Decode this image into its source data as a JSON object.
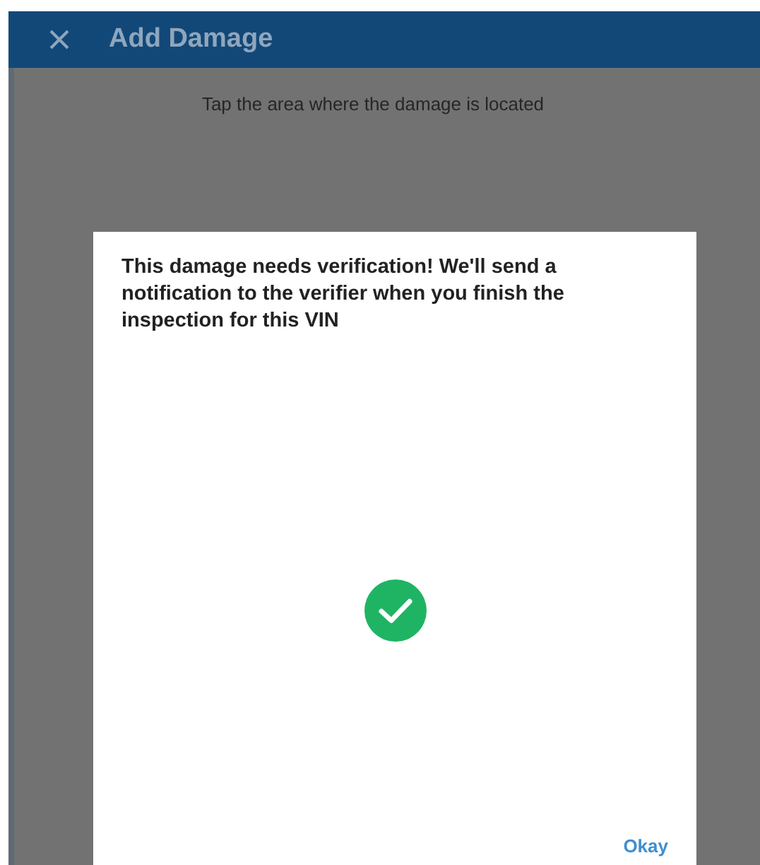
{
  "app_bar": {
    "title": "Add Damage"
  },
  "instruction": "Tap the area where the damage is located",
  "dialog": {
    "message": "This damage needs verification! We'll send a notification to the verifier when you finish the inspection for this VIN",
    "button": "Okay"
  }
}
